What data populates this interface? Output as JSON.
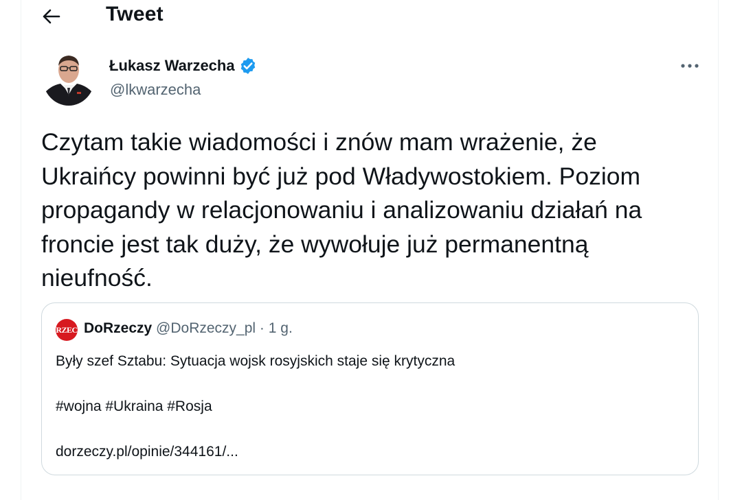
{
  "header": {
    "title": "Tweet",
    "back_icon": "arrow-left-icon"
  },
  "author": {
    "name": "Łukasz Warzecha",
    "handle": "@lkwarzecha",
    "verified_color": "#1d9bf0",
    "more_icon": "more-horizontal-icon"
  },
  "tweet": {
    "text": "Czytam takie wiadomości i znów mam wrażenie, że\nUkraińcy powinni być już pod Władywostokiem. Poziom\npropagandy w relacjonowaniu i analizowaniu działań na\nfroncie jest tak duży, że wywołuje już permanentną\nnieufność."
  },
  "quote": {
    "avatar_text": "RZEC",
    "name": "DoRzeczy",
    "handle": "@DoRzeczy_pl",
    "separator": "·",
    "time": "1 g.",
    "line1": "Były szef Sztabu: Sytuacja wojsk rosyjskich staje się krytyczna",
    "line2": "#wojna #Ukraina #Rosja",
    "line3": "dorzeczy.pl/opinie/344161/..."
  },
  "colors": {
    "text": "#0f1419",
    "secondary": "#536471",
    "border": "#cfd9de",
    "verified": "#1d9bf0",
    "brand_red": "#d71920"
  }
}
